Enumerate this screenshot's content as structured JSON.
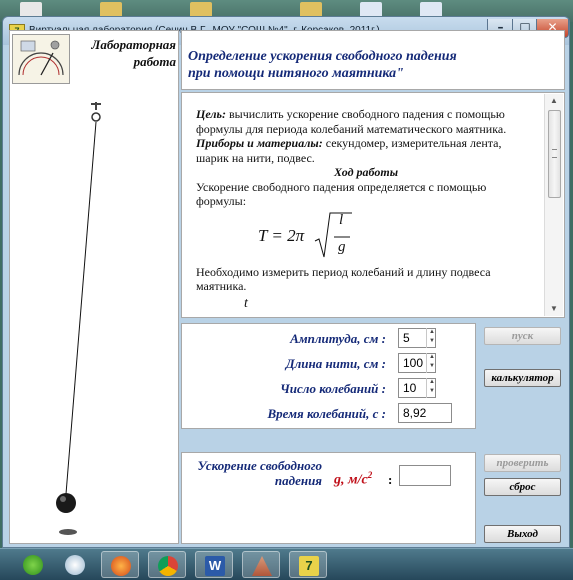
{
  "window": {
    "title": "Виртуальная лаборатория  (Сенин В.Г., МОУ \"СОШ №4\", г. Корсаков, 2011г.)",
    "min_label": "–",
    "max_label": "□",
    "close_label": "✕"
  },
  "header": {
    "lab_title_line1": "Лабораторная",
    "lab_title_line2": "работа",
    "topic_line1": "Определение ускорения свободного падения",
    "topic_line2": "при помощи нитяного маятника\""
  },
  "instructions": {
    "goal_label": "Цель:",
    "goal_text": " вычислить ускорение свободного падения с помощью формулы для периода колебаний математического маятника.",
    "materials_label": "Приборы и материалы:",
    "materials_text": " секундомер, измерительная лента, шарик на нити, подвес.",
    "procedure_heading": "Ход работы",
    "procedure_text": "Ускорение свободного падения определяется с помощью формулы:",
    "formula_lhs": "T = 2π",
    "formula_num": "l",
    "formula_den": "g",
    "measure_text": "Необходимо измерить период колебаний и длину подвеса маятника.",
    "cut_symbol": "t"
  },
  "inputs": {
    "amplitude_label": "Амплитуда, см :",
    "amplitude_value": "5",
    "length_label": "Длина нити, см :",
    "length_value": "100",
    "count_label": "Число колебаний :",
    "count_value": "10",
    "time_label": "Время колебаний, с :",
    "time_value": "8,92"
  },
  "buttons": {
    "start": "пуск",
    "calculator": "калькулятор",
    "check": "проверить",
    "reset": "сброс",
    "exit": "Выход"
  },
  "result": {
    "label_line1": "Ускорение свободного",
    "label_line2": "падения",
    "symbol": "g, м/с",
    "symbol_sup": "2",
    "colon": ":",
    "value": ""
  },
  "colors": {
    "accent_blue": "#152a78",
    "result_red": "#c0101a"
  }
}
